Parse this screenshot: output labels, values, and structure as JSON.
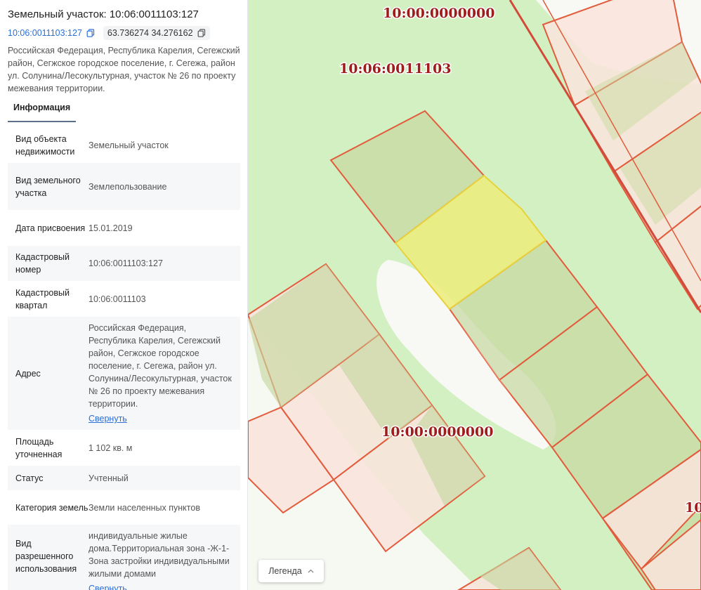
{
  "panel": {
    "title": "Земельный участок: 10:06:0011103:127",
    "cadastral_link": "10:06:0011103:127",
    "coordinates": "63.736274 34.276162",
    "address": "Российская Федерация, Республика Карелия, Сегежский район, Сегжское городское поселение, г. Сегежа, район ул. Солунина/Лесокультурная, участок № 26 по проекту межевания территории.",
    "tab_info": "Информация",
    "rows": [
      {
        "label": "Вид объекта недвижимости",
        "value": "Земельный участок"
      },
      {
        "label": "Вид земельного участка",
        "value": "Землепользование"
      },
      {
        "label": "Дата присвоения",
        "value": "15.01.2019"
      },
      {
        "label": "Кадастровый номер",
        "value": "10:06:0011103:127"
      },
      {
        "label": "Кадастровый квартал",
        "value": "10:06:0011103"
      },
      {
        "label": "Адрес",
        "value": "Российская Федерация, Республика Карелия, Сегежский район, Сегжское городское поселение, г. Сегежа, район ул. Солунина/Лесокультурная, участок № 26 по проекту межевания территории.",
        "link": "Свернуть"
      },
      {
        "label": "Площадь уточненная",
        "value": "1 102 кв. м"
      },
      {
        "label": "Статус",
        "value": "Учтенный"
      },
      {
        "label": "Категория земель",
        "value": "Земли населенных пунктов"
      },
      {
        "label": "Вид разрешенного использования",
        "value": "индивидуальные жилые дома.Территориальная зона -Ж-1- Зона застройки индивидуальными жилыми домами",
        "link": "Свернуть"
      }
    ]
  },
  "map": {
    "labels": [
      "10:00:0000000",
      "10:06:0011103",
      "10:00:0000000",
      "10"
    ],
    "legend_button": "Легенда",
    "colors": {
      "background": "#d3f0c2",
      "parcel_fill": "#f9e4dc",
      "parcel_stroke": "#e25b3c",
      "selected_fill": "#e9ec7a",
      "selected_stroke": "#e8d23c",
      "label": "#9e1c1c"
    }
  }
}
